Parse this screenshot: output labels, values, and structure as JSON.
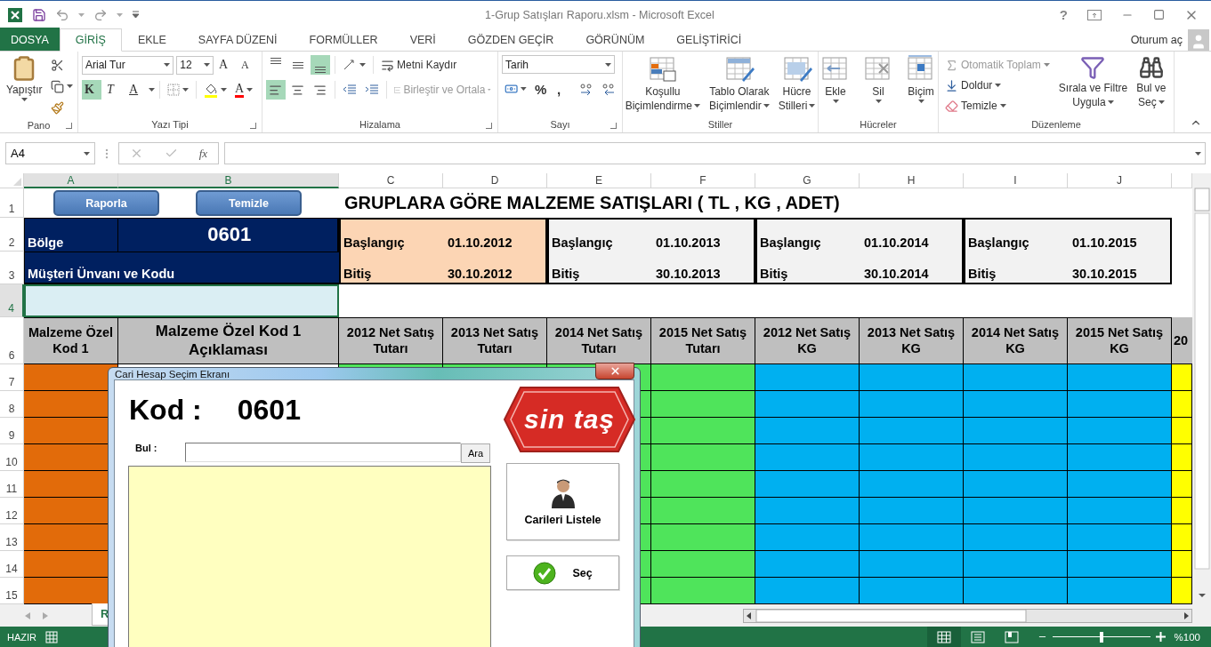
{
  "window": {
    "title": "1-Grup Satışları Raporu.xlsm - Microsoft Excel",
    "help": "?"
  },
  "ribbon_tabs": [
    {
      "label": "DOSYA",
      "kind": "file",
      "selected": false
    },
    {
      "label": "GİRİŞ",
      "kind": "tab",
      "selected": true
    },
    {
      "label": "EKLE",
      "kind": "tab",
      "selected": false
    },
    {
      "label": "SAYFA DÜZENİ",
      "kind": "tab",
      "selected": false
    },
    {
      "label": "FORMÜLLER",
      "kind": "tab",
      "selected": false
    },
    {
      "label": "VERİ",
      "kind": "tab",
      "selected": false
    },
    {
      "label": "GÖZDEN GEÇİR",
      "kind": "tab",
      "selected": false
    },
    {
      "label": "GÖRÜNÜM",
      "kind": "tab",
      "selected": false
    },
    {
      "label": "GELİŞTİRİCİ",
      "kind": "tab",
      "selected": false
    }
  ],
  "account": "Oturum aç",
  "ribbon": {
    "clipboard": {
      "label": "Pano",
      "paste": "Yapıştır"
    },
    "font": {
      "label": "Yazı Tipi",
      "font_name": "Arial Tur",
      "font_size": "12",
      "grow": "A",
      "shrink": "A",
      "font_color": "A",
      "styles": [
        {
          "label": "K",
          "kind": "bold",
          "selected": true
        },
        {
          "label": "T",
          "kind": "italic",
          "selected": false
        },
        {
          "label": "A",
          "kind": "underline",
          "selected": false
        }
      ]
    },
    "alignment": {
      "label": "Hizalama",
      "wrap": "Metni Kaydır",
      "merge": {
        "label": "Birleştir ve Ortala",
        "disabled": true
      },
      "vertical": [
        {
          "kind": "top",
          "selected": false
        },
        {
          "kind": "middle",
          "selected": false
        },
        {
          "kind": "bottom",
          "selected": true
        }
      ],
      "horizontal": [
        {
          "kind": "left",
          "selected": true
        },
        {
          "kind": "center",
          "selected": false
        },
        {
          "kind": "right",
          "selected": false
        }
      ]
    },
    "number": {
      "label": "Sayı",
      "format": "Tarih",
      "percent": "%",
      "comma": ","
    },
    "styles": {
      "label": "Stiller",
      "items": [
        {
          "kind": "conditional",
          "lines": [
            "Koşullu",
            "Biçimlendirme"
          ]
        },
        {
          "kind": "table",
          "lines": [
            "Tablo Olarak",
            "Biçimlendir"
          ]
        },
        {
          "kind": "cell",
          "lines": [
            "Hücre",
            "Stilleri"
          ]
        }
      ]
    },
    "cells": {
      "label": "Hücreler",
      "items": [
        {
          "kind": "insert",
          "label": "Ekle"
        },
        {
          "kind": "delete",
          "label": "Sil"
        },
        {
          "kind": "format",
          "label": "Biçim"
        }
      ]
    },
    "editing": {
      "label": "Düzenleme",
      "autosum": {
        "label": "Otomatik Toplam",
        "disabled": true
      },
      "fill": "Doldur",
      "clear": "Temizle",
      "sort": [
        "Sırala ve Filtre",
        "Uygula"
      ],
      "find": [
        "Bul ve",
        "Seç"
      ]
    }
  },
  "formula_bar": {
    "name_box": "A4",
    "function_label": "fx"
  },
  "sheet": {
    "columns": [
      {
        "letter": "A",
        "selected": true,
        "header": "Malzeme Özel Kod 1",
        "color": "#e26b0a"
      },
      {
        "letter": "B",
        "selected": true,
        "header": "Malzeme Özel Kod 1 Açıklaması"
      },
      {
        "letter": "C",
        "selected": false,
        "header": "2012 Net Satış Tutarı",
        "color": "#4fe45b"
      },
      {
        "letter": "D",
        "selected": false,
        "header": "2013 Net Satış Tutarı",
        "color": "#4fe45b"
      },
      {
        "letter": "E",
        "selected": false,
        "header": "2014 Net Satış Tutarı",
        "color": "#4fe45b"
      },
      {
        "letter": "F",
        "selected": false,
        "header": "2015 Net Satış Tutarı",
        "color": "#4fe45b"
      },
      {
        "letter": "G",
        "selected": false,
        "header": "2012 Net Satış KG",
        "color": "#00b0f0"
      },
      {
        "letter": "H",
        "selected": false,
        "header": "2013 Net Satış KG",
        "color": "#00b0f0"
      },
      {
        "letter": "I",
        "selected": false,
        "header": "2014 Net Satış KG",
        "color": "#00b0f0"
      },
      {
        "letter": "J",
        "selected": false,
        "header": "2015 Net Satış KG",
        "color": "#00b0f0"
      }
    ],
    "partial_column": {
      "header": "20",
      "color": "#ffff00"
    },
    "buttons": [
      "Raporla",
      "Temizle"
    ],
    "title": "GRUPLARA GÖRE MALZEME SATIŞLARI ( TL , KG , ADET)",
    "region": {
      "label": "Bölge",
      "value": "0601"
    },
    "customer_label": "Müşteri Ünvanı ve Kodu",
    "periods": [
      {
        "start_label": "Başlangıç",
        "start": "01.10.2012",
        "end_label": "Bitiş",
        "end": "30.10.2012",
        "highlighted": true
      },
      {
        "start_label": "Başlangıç",
        "start": "01.10.2013",
        "end_label": "Bitiş",
        "end": "30.10.2013",
        "highlighted": false
      },
      {
        "start_label": "Başlangıç",
        "start": "01.10.2014",
        "end_label": "Bitiş",
        "end": "30.10.2014",
        "highlighted": false
      },
      {
        "start_label": "Başlangıç",
        "start": "01.10.2015",
        "end_label": "Bitiş",
        "end": "30.10.2015",
        "highlighted": false
      }
    ],
    "header_rows": [
      {
        "number": "1",
        "selected": false
      },
      {
        "number": "2",
        "selected": false
      },
      {
        "number": "3",
        "selected": false
      },
      {
        "number": "4",
        "selected": true
      },
      {
        "number": "6",
        "selected": false
      }
    ],
    "body_rows": [
      "7",
      "8",
      "9",
      "10",
      "11",
      "12",
      "13",
      "14",
      "15"
    ]
  },
  "sheet_tabs": [
    {
      "label": "R",
      "selected": true
    }
  ],
  "status_bar": {
    "mode": "HAZIR",
    "views": [
      {
        "kind": "normal",
        "selected": true
      },
      {
        "kind": "page_layout",
        "selected": false
      },
      {
        "kind": "page_break",
        "selected": false
      }
    ],
    "zoom": {
      "level": 0.5,
      "reading": "%100"
    }
  },
  "dialog": {
    "title": "Cari Hesap Seçim Ekranı",
    "code_label": "Kod :",
    "code": "0601",
    "logo": "sin taş",
    "search_label": "Bul :",
    "search_button": "Ara",
    "buttons": [
      {
        "kind": "list",
        "label": "Carileri Listele"
      },
      {
        "kind": "select",
        "label": "Seç"
      }
    ]
  }
}
